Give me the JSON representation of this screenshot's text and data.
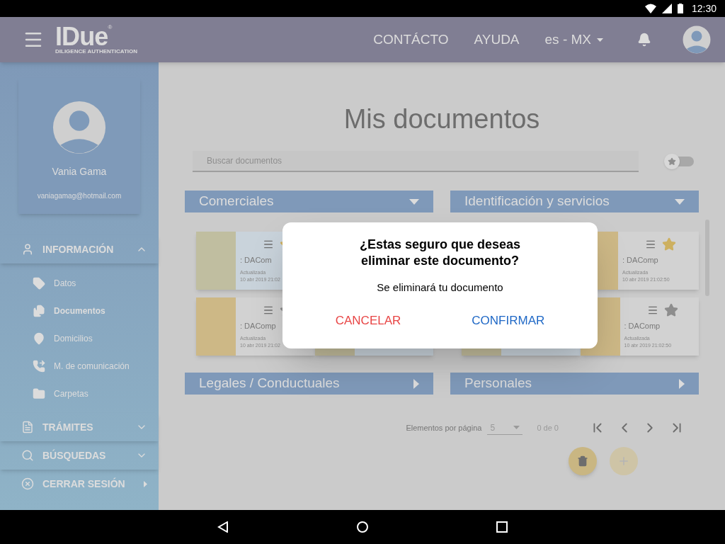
{
  "status_bar": {
    "time": "12:30"
  },
  "header": {
    "logo": "IDue",
    "logo_mark": "®",
    "logo_tagline": "DILIGENCE AUTHENTICATION",
    "nav": [
      "CONTÁCTO",
      "AYUDA"
    ],
    "language": "es - MX"
  },
  "profile": {
    "name": "Vania Gama",
    "email": "vaniagamag@hotmail.com"
  },
  "sidebar": [
    {
      "label": "INFORMACIÓN",
      "kind": "group",
      "expanded": true,
      "children": [
        {
          "label": "Datos",
          "selected": false
        },
        {
          "label": "Documentos",
          "selected": true
        },
        {
          "label": "Domicilios",
          "selected": false
        },
        {
          "label": "M. de comunicación",
          "selected": false
        },
        {
          "label": "Carpetas",
          "selected": false
        }
      ]
    },
    {
      "label": "TRÁMITES",
      "kind": "group",
      "expanded": false
    },
    {
      "label": "BÚSQUEDAS",
      "kind": "group",
      "expanded": false
    },
    {
      "label": "CERRAR SESIÓN",
      "kind": "link"
    }
  ],
  "page": {
    "title": "Mis documentos",
    "search_placeholder": "Buscar documentos",
    "favorites_only": false
  },
  "sections": [
    {
      "title": "Comerciales",
      "expanded": true,
      "rows": [
        [
          {
            "color": "#c0bea0",
            "selected": true,
            "favorite": true,
            "name": ": DACom",
            "updated": "Actualizada",
            "date": "10 abr 2019 21:02"
          }
        ],
        [
          {
            "color": "#cdb886",
            "selected": false,
            "favorite": false,
            "name": ": DAComp",
            "updated": "Actualizada",
            "date": "10 abr 2019 21:02"
          },
          {
            "selected": true
          }
        ]
      ]
    },
    {
      "title": "Identificación y servicios",
      "expanded": true,
      "rows": [
        [
          {
            "color": "#cdb886",
            "selected": false,
            "favorite": true,
            "name": ": DAComp",
            "updated": "Actualizada",
            "date": "10 abr 2019 21:02:50"
          }
        ],
        [
          {
            "selected": true
          },
          {
            "color": "#cdb886",
            "selected": false,
            "favorite": false,
            "name": ": DAComp",
            "updated": "Actualizada",
            "date": "10 abr 2019 21:02:50"
          }
        ]
      ]
    },
    {
      "title": "Legales / Conductuales",
      "expanded": false
    },
    {
      "title": "Personales",
      "expanded": false
    }
  ],
  "pagination": {
    "label": "Elementos por página",
    "page_size": "5",
    "range": "0 de 0"
  },
  "dialog": {
    "title": "¿Estas seguro que deseas eliminar este documento?",
    "message": "Se eliminará tu documento",
    "cancel": "CANCELAR",
    "confirm": "CONFIRMAR"
  }
}
